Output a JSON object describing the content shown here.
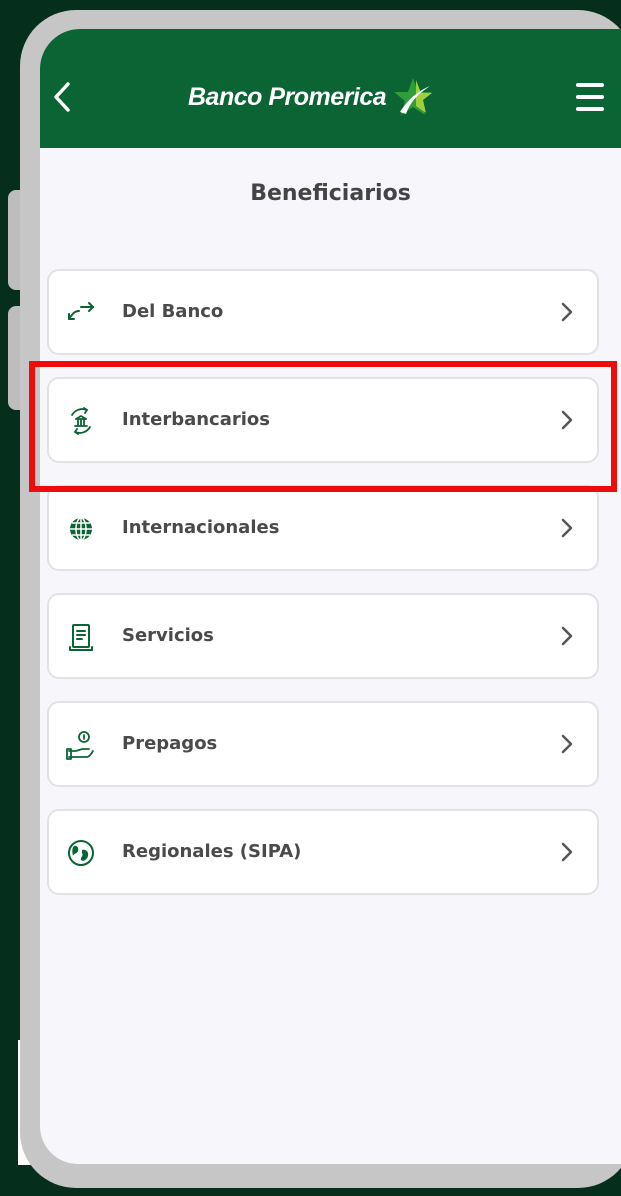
{
  "header": {
    "brand_name": "Banco Promerica",
    "back_icon": "chevron-left-icon",
    "menu_icon": "hamburger-menu-icon",
    "background_color": "#0a6434",
    "star_colors": [
      "#2e9e3c",
      "#9fd03a",
      "#ffffff"
    ]
  },
  "page": {
    "title": "Beneficiarios"
  },
  "menu": {
    "items": [
      {
        "label": "Del Banco",
        "icon": "transfer-arrows-icon"
      },
      {
        "label": "Interbancarios",
        "icon": "bank-exchange-icon"
      },
      {
        "label": "Internacionales",
        "icon": "globe-icon"
      },
      {
        "label": "Servicios",
        "icon": "receipt-icon"
      },
      {
        "label": "Prepagos",
        "icon": "hand-coin-icon"
      },
      {
        "label": "Regionales (SIPA)",
        "icon": "earth-icon"
      }
    ]
  },
  "highlight": {
    "target": "Interbancarios",
    "color": "#ee0d0d"
  }
}
